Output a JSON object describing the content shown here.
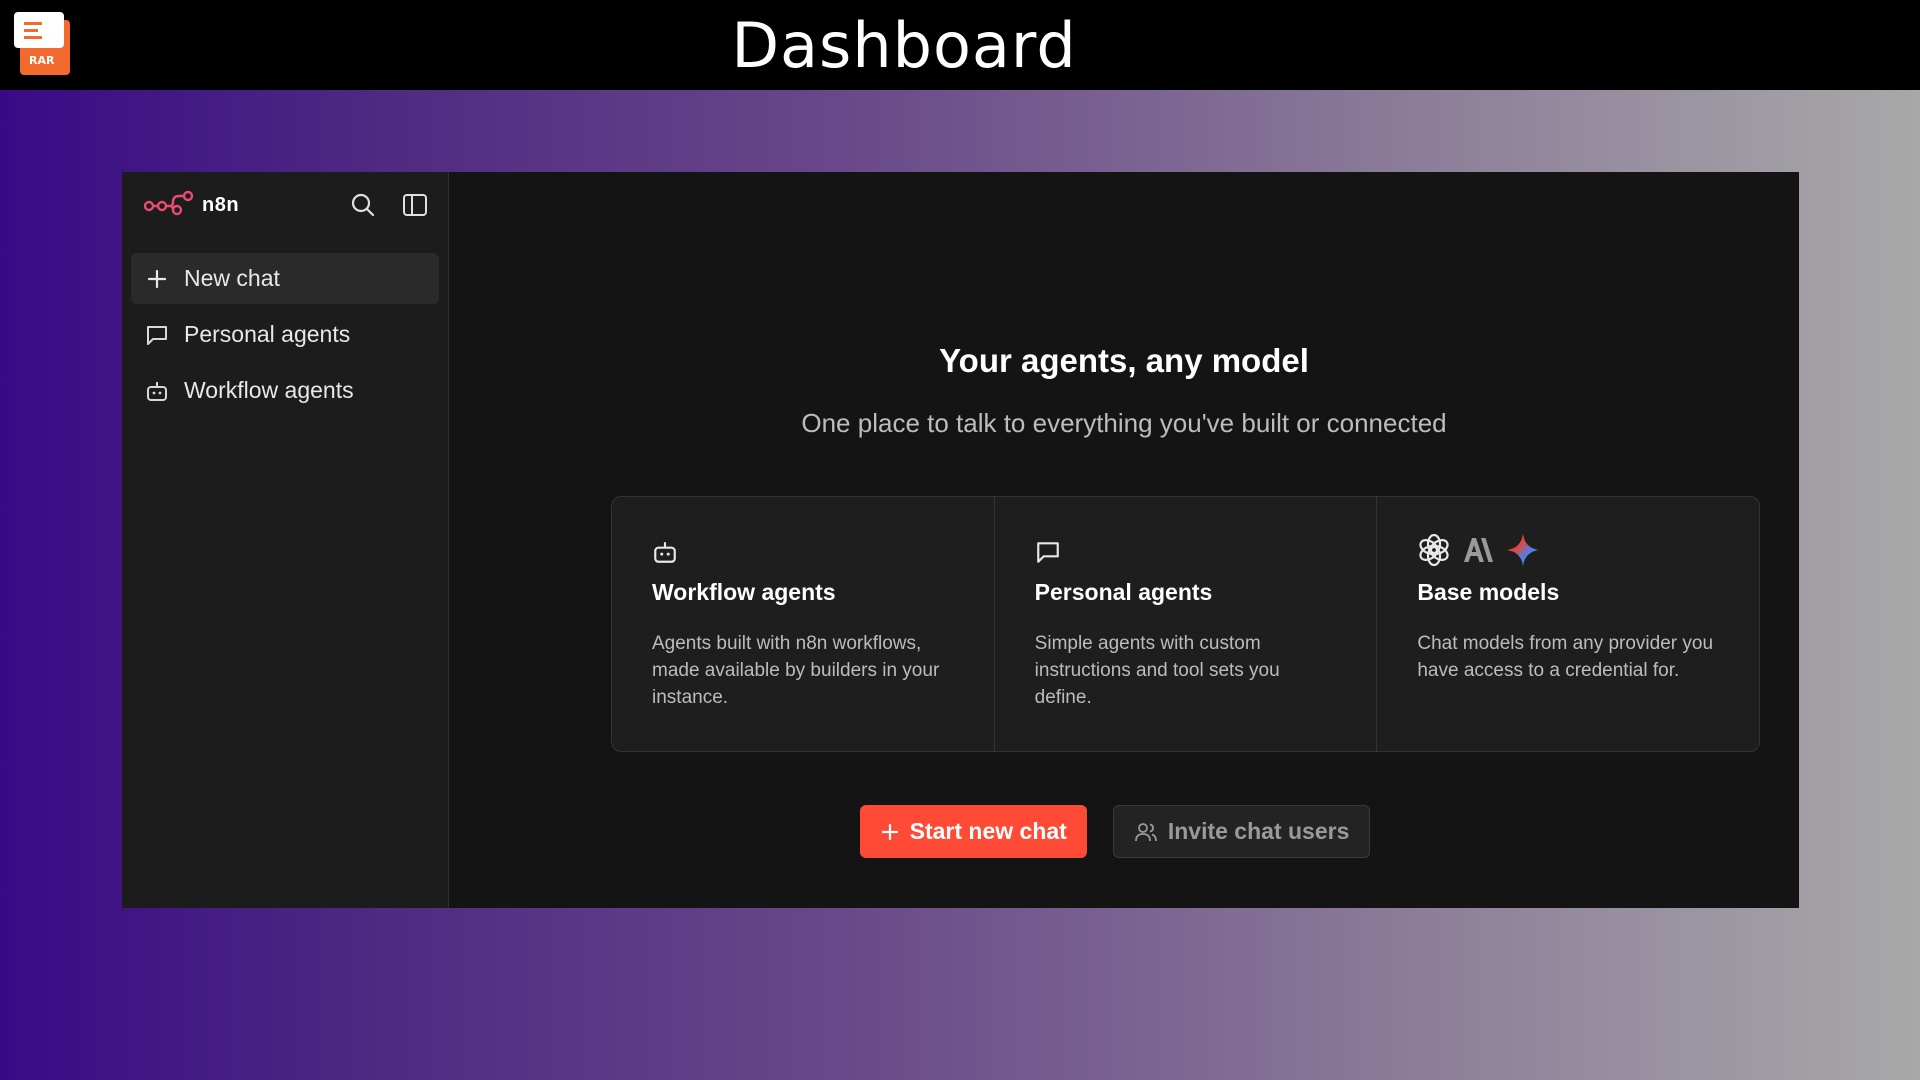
{
  "topbar": {
    "title": "Dashboard",
    "badge_text": "RAR",
    "badge_color": "#f26a2e"
  },
  "sidebar": {
    "brand_name": "n8n",
    "brand_color": "#ea4b71",
    "items": [
      {
        "label": "New chat",
        "icon": "plus-icon",
        "active": true
      },
      {
        "label": "Personal agents",
        "icon": "chat-bubble-icon",
        "active": false
      },
      {
        "label": "Workflow agents",
        "icon": "robot-icon",
        "active": false
      }
    ]
  },
  "main": {
    "title": "Your agents, any model",
    "subtitle": "One place to talk to everything you've built or connected",
    "cards": [
      {
        "icon": "robot-icon",
        "title": "Workflow agents",
        "description": "Agents built with n8n workflows, made available by builders in your instance."
      },
      {
        "icon": "chat-bubble-icon",
        "title": "Personal agents",
        "description": "Simple agents with custom instructions and tool sets you define."
      },
      {
        "icons": [
          "openai-logo-icon",
          "anthropic-logo-icon",
          "gemini-logo-icon"
        ],
        "title": "Base models",
        "description": "Chat models from any provider you have access to a credential for."
      }
    ],
    "actions": {
      "primary_label": "Start new chat",
      "secondary_label": "Invite chat users"
    }
  },
  "colors": {
    "accent": "#ff4b36",
    "app_background": "#141414",
    "sidebar_background": "#1c1c1c"
  }
}
